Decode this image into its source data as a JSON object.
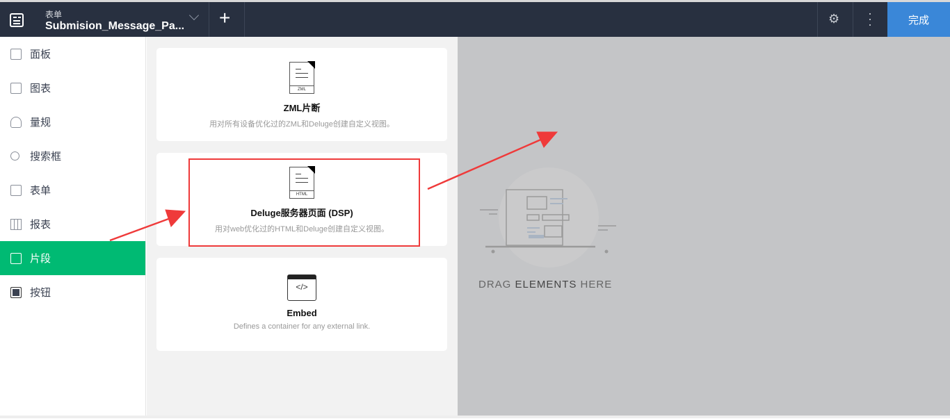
{
  "header": {
    "subtitle": "表单",
    "title": "Submision_Message_Pa...",
    "done_label": "完成"
  },
  "sidebar": {
    "items": [
      {
        "label": "面板",
        "icon": "dashboard-icon"
      },
      {
        "label": "图表",
        "icon": "chart-icon"
      },
      {
        "label": "量规",
        "icon": "gauge-icon"
      },
      {
        "label": "搜索框",
        "icon": "search-icon"
      },
      {
        "label": "表单",
        "icon": "form-icon"
      },
      {
        "label": "报表",
        "icon": "report-icon"
      },
      {
        "label": "片段",
        "icon": "snippet-icon",
        "active": true
      },
      {
        "label": "按钮",
        "icon": "button-icon"
      }
    ]
  },
  "cards": [
    {
      "icon_label": "ZML",
      "title": "ZML片断",
      "desc": "用对所有设备优化过的ZML和Deluge创建自定义视图。"
    },
    {
      "icon_label": "HTML",
      "title": "Deluge服务器页面 (DSP)",
      "desc": "用对web优化过的HTML和Deluge创建自定义视图。"
    },
    {
      "icon_label": "</>",
      "title": "Embed",
      "desc": "Defines a container for any external link."
    }
  ],
  "canvas": {
    "drag_a": "DRAG ",
    "drag_b": "ELEMENTS",
    "drag_c": " HERE"
  },
  "colors": {
    "header": "#283040",
    "accent": "#00ba73",
    "done": "#3a87d8",
    "annotation": "#ef3a3a"
  }
}
